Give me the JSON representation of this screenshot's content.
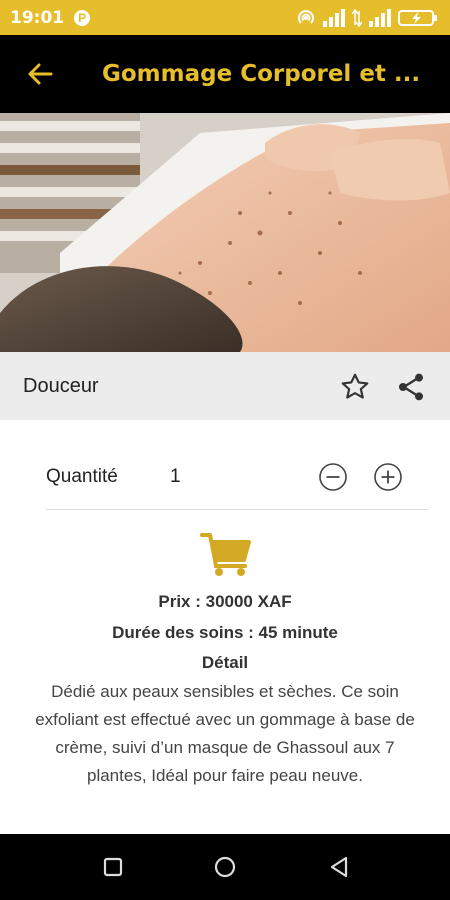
{
  "status_bar": {
    "time": "19:01",
    "app_badge": "P",
    "background_color": "#e6bd2b"
  },
  "app_bar": {
    "title": "Gommage Corporel et ...",
    "back_icon": "arrow-left-icon",
    "title_color": "#e6bd2b"
  },
  "hero": {
    "image": "back-scrub-massage-photo"
  },
  "product": {
    "name": "Douceur",
    "favorite_icon": "star-outline-icon",
    "share_icon": "share-icon"
  },
  "quantity": {
    "label": "Quantité",
    "value": "1",
    "decrement_icon": "minus-circle-icon",
    "increment_icon": "plus-circle-icon"
  },
  "cart": {
    "icon": "cart-icon",
    "color": "#d4a925"
  },
  "info": {
    "price": "Prix : 30000 XAF",
    "duration": "Durée des soins : 45 minute",
    "detail_title": "Détail",
    "detail_text": "Dédié aux peaux sensibles et sèches. Ce soin exfoliant est effectué avec un gommage à base de crème, suivi d’un masque de Ghassoul aux 7 plantes, Idéal pour faire peau neuve."
  },
  "nav_bar": {
    "recents_icon": "square-icon",
    "home_icon": "circle-icon",
    "back_icon": "triangle-back-icon"
  }
}
